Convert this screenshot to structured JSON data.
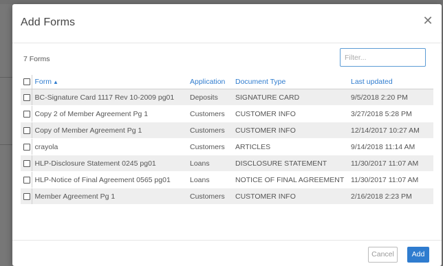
{
  "dialog": {
    "title": "Add Forms",
    "close_icon": "close-icon",
    "count_text": "7 Forms",
    "filter": {
      "placeholder": "Filter...",
      "value": ""
    }
  },
  "table": {
    "columns": {
      "form": "Form",
      "application": "Application",
      "document_type": "Document Type",
      "last_updated": "Last updated"
    },
    "sort_icon": "sort-ascending-icon",
    "rows": [
      {
        "form": "BC-Signature Card 1117 Rev 10-2009 pg01",
        "application": "Deposits",
        "document_type": "SIGNATURE CARD",
        "last_updated": "9/5/2018 2:20 PM"
      },
      {
        "form": "Copy 2 of Member Agreement Pg 1",
        "application": "Customers",
        "document_type": "CUSTOMER INFO",
        "last_updated": "3/27/2018 5:28 PM"
      },
      {
        "form": "Copy of Member Agreement Pg 1",
        "application": "Customers",
        "document_type": "CUSTOMER INFO",
        "last_updated": "12/14/2017 10:27 AM"
      },
      {
        "form": "crayola",
        "application": "Customers",
        "document_type": "ARTICLES",
        "last_updated": "9/14/2018 11:14 AM"
      },
      {
        "form": "HLP-Disclosure Statement 0245 pg01",
        "application": "Loans",
        "document_type": "DISCLOSURE STATEMENT",
        "last_updated": "11/30/2017 11:07 AM"
      },
      {
        "form": "HLP-Notice of Final Agreement 0565 pg01",
        "application": "Loans",
        "document_type": "NOTICE OF FINAL AGREEMENT",
        "last_updated": "11/30/2017 11:07 AM"
      },
      {
        "form": "Member Agreement Pg 1",
        "application": "Customers",
        "document_type": "CUSTOMER INFO",
        "last_updated": "2/16/2018 2:23 PM"
      }
    ]
  },
  "footer": {
    "cancel_label": "Cancel",
    "add_label": "Add"
  },
  "colors": {
    "accent": "#2f7ccf",
    "row_stripe": "#eeeeee",
    "backdrop": "#7a7a7a"
  }
}
